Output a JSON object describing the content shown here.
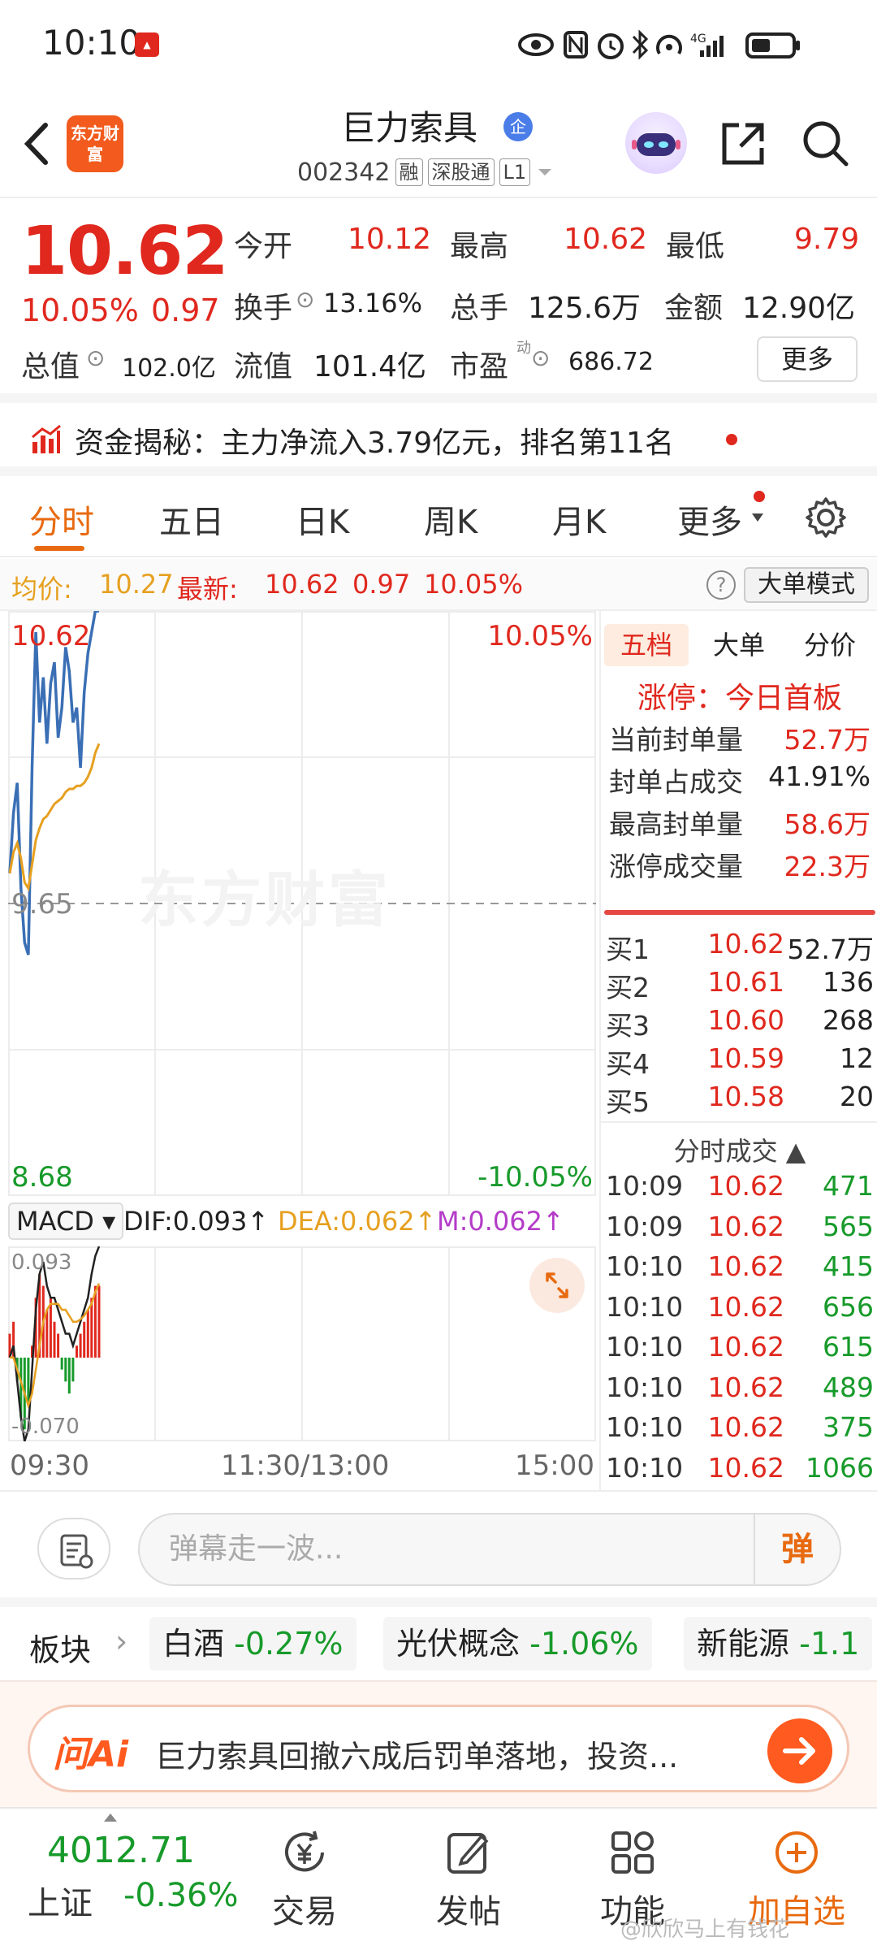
{
  "status": {
    "time": "10:10",
    "network": "4G"
  },
  "header": {
    "brand_logo_text": "东方财富",
    "title": "巨力索具",
    "badge": "企",
    "code": "002342",
    "tags": [
      "融",
      "深股通",
      "L1"
    ]
  },
  "quote": {
    "price": "10.62",
    "change_pct": "10.05%",
    "change_abs": "0.97",
    "open_label": "今开",
    "open": "10.12",
    "high_label": "最高",
    "high": "10.62",
    "low_label": "最低",
    "low": "9.79",
    "turnover_label": "换手",
    "turnover": "13.16%",
    "volume_label": "总手",
    "volume": "125.6万",
    "amount_label": "金额",
    "amount": "12.90亿",
    "mktcap_label": "总值",
    "mktcap": "102.0亿",
    "float_label": "流值",
    "float": "101.4亿",
    "pe_label": "市盈",
    "pe_sup": "动",
    "pe": "686.72",
    "more": "更多"
  },
  "funds": {
    "text": "资金揭秘：主力净流入3.79亿元，排名第11名"
  },
  "tabs": [
    "分时",
    "五日",
    "日K",
    "周K",
    "月K",
    "更多"
  ],
  "avg_row": {
    "avg_label": "均价:",
    "avg": "10.27",
    "latest_label": "最新:",
    "latest": "10.62",
    "chg": "0.97",
    "pct": "10.05%",
    "big_order_btn": "大单模式"
  },
  "chart_data": {
    "type": "line",
    "y_top_label": "10.62",
    "y_mid_label": "9.65",
    "y_bottom_label": "8.68",
    "pct_top_label": "10.05%",
    "pct_bottom_label": "-10.05%",
    "ylim": [
      8.68,
      10.62
    ],
    "x_labels": [
      "09:30",
      "11:30/13:00",
      "15:00"
    ],
    "watermark": "东方财富",
    "series": [
      {
        "name": "price",
        "color": "#3a6fb5",
        "values": [
          9.75,
          9.95,
          10.05,
          9.7,
          9.52,
          9.48,
          10.1,
          10.55,
          10.25,
          10.4,
          10.18,
          10.38,
          10.45,
          10.2,
          10.3,
          10.5,
          10.42,
          10.25,
          10.3,
          10.1,
          10.35,
          10.48,
          10.55,
          10.62,
          10.62
        ]
      },
      {
        "name": "avg",
        "color": "#e6a020",
        "values": [
          9.75,
          9.82,
          9.85,
          9.8,
          9.72,
          9.7,
          9.78,
          9.86,
          9.9,
          9.93,
          9.94,
          9.96,
          9.98,
          9.99,
          10.0,
          10.02,
          10.03,
          10.03,
          10.04,
          10.04,
          10.05,
          10.07,
          10.1,
          10.15,
          10.18
        ]
      }
    ],
    "macd": {
      "indicator": "MACD",
      "dif_label": "DIF:0.093",
      "dea_label": "DEA:0.062",
      "m_label": "M:0.062",
      "top_label": "0.093",
      "bottom_label": "-0.070",
      "ylim": [
        -0.07,
        0.093
      ],
      "bars": [
        0.02,
        0.03,
        -0.02,
        -0.05,
        -0.06,
        -0.04,
        0.01,
        0.05,
        0.07,
        0.06,
        0.04,
        0.05,
        0.03,
        0.02,
        -0.01,
        -0.02,
        -0.03,
        -0.02,
        0.01,
        0.02,
        0.03,
        0.04,
        0.05,
        0.06,
        0.06
      ],
      "dif": [
        0.0,
        0.01,
        -0.02,
        -0.05,
        -0.07,
        -0.06,
        -0.01,
        0.04,
        0.07,
        0.08,
        0.06,
        0.05,
        0.05,
        0.04,
        0.03,
        0.02,
        0.02,
        0.01,
        0.02,
        0.03,
        0.04,
        0.05,
        0.07,
        0.085,
        0.093
      ],
      "dea": [
        0.0,
        0.0,
        -0.01,
        -0.02,
        -0.03,
        -0.04,
        -0.03,
        -0.01,
        0.01,
        0.03,
        0.04,
        0.045,
        0.045,
        0.045,
        0.04,
        0.04,
        0.035,
        0.03,
        0.03,
        0.032,
        0.035,
        0.04,
        0.045,
        0.055,
        0.062
      ]
    }
  },
  "panel": {
    "tabs": [
      "五档",
      "大单",
      "分价"
    ],
    "limit_title": "涨停：今日首板",
    "limit_rows": [
      {
        "label": "当前封单量",
        "value": "52.7万",
        "red": true
      },
      {
        "label": "封单占成交",
        "value": "41.91%",
        "red": false
      },
      {
        "label": "最高封单量",
        "value": "58.6万",
        "red": true
      },
      {
        "label": "涨停成交量",
        "value": "22.3万",
        "red": true
      }
    ],
    "book": [
      {
        "label": "买1",
        "price": "10.62",
        "vol": "52.7万"
      },
      {
        "label": "买2",
        "price": "10.61",
        "vol": "136"
      },
      {
        "label": "买3",
        "price": "10.60",
        "vol": "268"
      },
      {
        "label": "买4",
        "price": "10.59",
        "vol": "12"
      },
      {
        "label": "买5",
        "price": "10.58",
        "vol": "20"
      }
    ],
    "ticks_title": "分时成交",
    "ticks": [
      {
        "time": "10:09",
        "price": "10.62",
        "vol": "471"
      },
      {
        "time": "10:09",
        "price": "10.62",
        "vol": "565"
      },
      {
        "time": "10:10",
        "price": "10.62",
        "vol": "415"
      },
      {
        "time": "10:10",
        "price": "10.62",
        "vol": "656"
      },
      {
        "time": "10:10",
        "price": "10.62",
        "vol": "615"
      },
      {
        "time": "10:10",
        "price": "10.62",
        "vol": "489"
      },
      {
        "time": "10:10",
        "price": "10.62",
        "vol": "375"
      },
      {
        "time": "10:10",
        "price": "10.62",
        "vol": "1066"
      }
    ]
  },
  "danmu": {
    "placeholder": "弹幕走一波...",
    "send": "弹"
  },
  "sectors": {
    "label": "板块",
    "items": [
      {
        "name": "白酒",
        "chg": "-0.27%"
      },
      {
        "name": "光伏概念",
        "chg": "-1.06%"
      },
      {
        "name": "新能源",
        "chg": "-1.1"
      }
    ]
  },
  "ai": {
    "logo": "问Ai",
    "text": "巨力索具回撤六成后罚单落地，投资..."
  },
  "bottom_nav": {
    "index_value": "4012.71",
    "index_name": "上证",
    "index_chg": "-0.36%",
    "items": [
      "交易",
      "发帖",
      "功能",
      "加自选"
    ],
    "watermark": "@欣欣马上有钱花"
  }
}
